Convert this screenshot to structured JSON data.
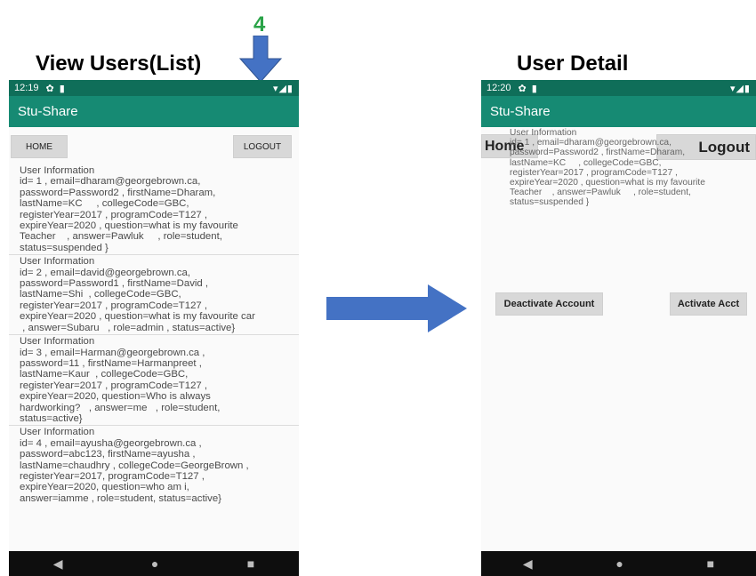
{
  "captions": {
    "left": "View Users(List)",
    "right": "User Detail",
    "step_number": "4"
  },
  "colors": {
    "app_bar": "#168a73",
    "status_bar": "#0f6e59",
    "arrow": "#4472c4",
    "step_number": "#2aa348"
  },
  "left_phone": {
    "status_time": "12:19",
    "app_title": "Stu-Share",
    "home_label": "HOME",
    "logout_label": "LOGOUT",
    "users": [
      "User Information\nid= 1 , email=dharam@georgebrown.ca,\npassword=Password2 , firstName=Dharam,\nlastName=KC     , collegeCode=GBC,\nregisterYear=2017 , programCode=T127 ,\nexpireYear=2020 , question=what is my favourite\nTeacher    , answer=Pawluk     , role=student,\nstatus=suspended }",
      "User Information\nid= 2 , email=david@georgebrown.ca,\npassword=Password1 , firstName=David ,\nlastName=Shi  , collegeCode=GBC,\nregisterYear=2017 , programCode=T127 ,\nexpireYear=2020 , question=what is my favourite car\n , answer=Subaru   , role=admin , status=active}",
      "User Information\nid= 3 , email=Harman@georgebrown.ca ,\npassword=11 , firstName=Harmanpreet ,\nlastName=Kaur  , collegeCode=GBC,\nregisterYear=2017 , programCode=T127 ,\nexpireYear=2020, question=Who is always\nhardworking?   , answer=me   , role=student,\nstatus=active}",
      "User Information\nid= 4 , email=ayusha@georgebrown.ca ,\npassword=abc123, firstName=ayusha ,\nlastName=chaudhry , collegeCode=GeorgeBrown ,\nregisterYear=2017, programCode=T127 ,\nexpireYear=2020, question=who am i,\nanswer=iamme , role=student, status=active}"
    ]
  },
  "right_phone": {
    "status_time": "12:20",
    "app_title": "Stu-Share",
    "home_label": "Home",
    "logout_label": "Logout",
    "detail_text": "User Information\nid= 1 , email=dharam@georgebrown.ca,\npassword=Password2 , firstName=Dharam,\nlastName=KC     , collegeCode=GBC,\nregisterYear=2017 , programCode=T127 ,\nexpireYear=2020 , question=what is my favourite\nTeacher    , answer=Pawluk     , role=student,\nstatus=suspended }",
    "deactivate_label": "Deactivate Account",
    "activate_label": "Activate Acct"
  }
}
